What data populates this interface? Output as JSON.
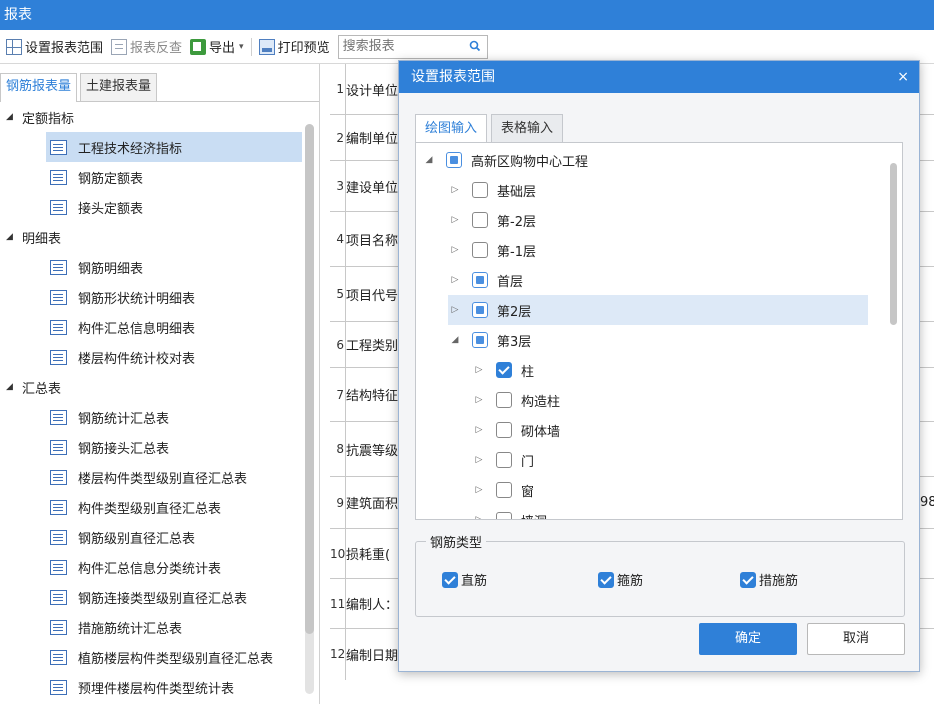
{
  "window": {
    "title": "报表"
  },
  "toolbar": {
    "set_range": "设置报表范围",
    "reverse_check": "报表反查",
    "export": "导出",
    "print_preview": "打印预览",
    "search_placeholder": "搜索报表"
  },
  "left_tabs": [
    "钢筋报表量",
    "土建报表量"
  ],
  "tree": {
    "groups": [
      {
        "label": "定额指标",
        "items": [
          "工程技术经济指标",
          "钢筋定额表",
          "接头定额表"
        ]
      },
      {
        "label": "明细表",
        "items": [
          "钢筋明细表",
          "钢筋形状统计明细表",
          "构件汇总信息明细表",
          "楼层构件统计校对表"
        ]
      },
      {
        "label": "汇总表",
        "items": [
          "钢筋统计汇总表",
          "钢筋接头汇总表",
          "楼层构件类型级别直径汇总表",
          "构件类型级别直径汇总表",
          "钢筋级别直径汇总表",
          "构件汇总信息分类统计表",
          "钢筋连接类型级别直径汇总表",
          "措施筋统计汇总表",
          "植筋楼层构件类型级别直径汇总表",
          "预埋件楼层构件类型统计表"
        ]
      }
    ],
    "selected": "工程技术经济指标"
  },
  "grid_rows": [
    {
      "n": "1",
      "text": "设计单位"
    },
    {
      "n": "2",
      "text": "编制单位"
    },
    {
      "n": "3",
      "text": "建设单位"
    },
    {
      "n": "4",
      "text": "项目名称"
    },
    {
      "n": "5",
      "text": "项目代号"
    },
    {
      "n": "6",
      "text": "工程类别"
    },
    {
      "n": "7",
      "text": "结构特征"
    },
    {
      "n": "8",
      "text": "抗震等级"
    },
    {
      "n": "9",
      "text": "建筑面积"
    },
    {
      "n": "10",
      "text": "损耗重("
    },
    {
      "n": "11",
      "text": "编制人："
    },
    {
      "n": "12",
      "text": "编制日期"
    }
  ],
  "grid_fragment": "98",
  "dialog": {
    "title": "设置报表范围",
    "close": "×",
    "tabs": [
      "绘图输入",
      "表格输入"
    ],
    "floor_tree": {
      "root": "高新区购物中心工程",
      "floors": [
        "基础层",
        "第-2层",
        "第-1层",
        "首层",
        "第2层",
        "第3层"
      ],
      "components": [
        "柱",
        "构造柱",
        "砌体墙",
        "门",
        "窗",
        "墙洞"
      ]
    },
    "rebar_type": {
      "legend": "钢筋类型",
      "options": [
        "直筋",
        "箍筋",
        "措施筋"
      ]
    },
    "ok": "确定",
    "cancel": "取消"
  }
}
